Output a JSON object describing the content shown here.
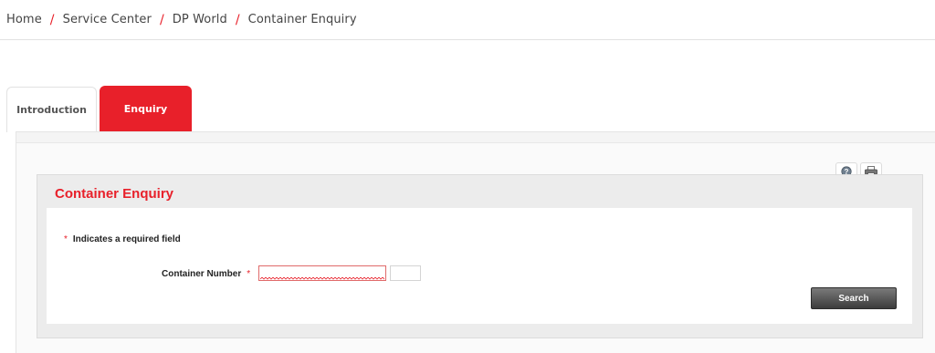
{
  "breadcrumb": {
    "items": [
      "Home",
      "Service Center",
      "DP World",
      "Container Enquiry"
    ],
    "separator": "/"
  },
  "tabs": [
    {
      "label": "Introduction",
      "active": false
    },
    {
      "label": "Enquiry",
      "active": true
    }
  ],
  "tools": {
    "help_icon": "help-icon",
    "print_icon": "print-icon"
  },
  "panel": {
    "title": "Container Enquiry",
    "required_note": "Indicates a required field",
    "required_marker": "*",
    "container_number_label": "Container Number",
    "container_number_value": "",
    "check_digit_value": "",
    "search_label": "Search"
  },
  "colors": {
    "accent": "#e8202a",
    "button": "#4a4a4a"
  }
}
